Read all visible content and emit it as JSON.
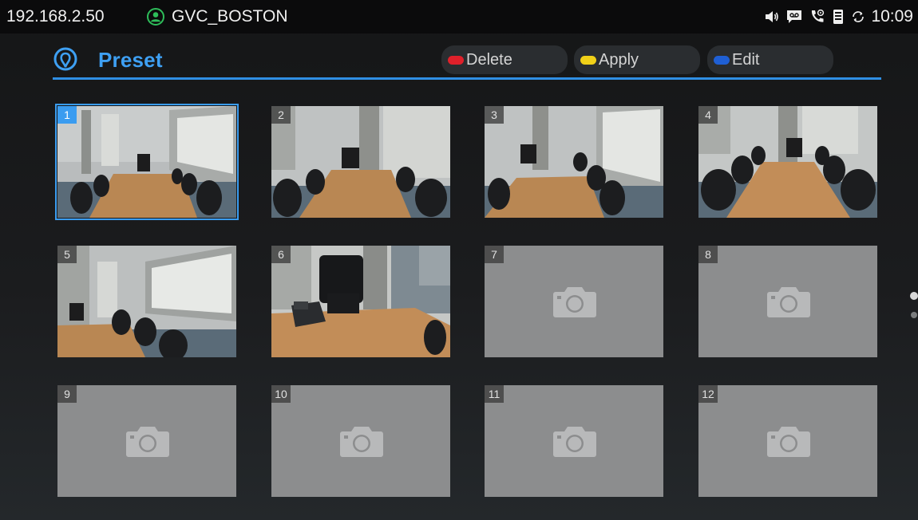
{
  "status_bar": {
    "ip": "192.168.2.50",
    "account_name": "GVC_BOSTON",
    "account_status_color": "#2ebd5a",
    "icons": [
      "volume-icon",
      "voicemail-icon",
      "call-settings-icon",
      "storage-icon",
      "sync-icon"
    ],
    "time": "10:09"
  },
  "header": {
    "title": "Preset",
    "accent_color": "#3ea0f3",
    "actions": [
      {
        "label": "Delete",
        "key_color": "#e0202a"
      },
      {
        "label": "Apply",
        "key_color": "#f0d018"
      },
      {
        "label": "Edit",
        "key_color": "#1f5fd4"
      }
    ]
  },
  "presets": [
    {
      "number": "1",
      "thumbnail": "conference-room-view",
      "selected": true
    },
    {
      "number": "2",
      "thumbnail": "conference-room-view"
    },
    {
      "number": "3",
      "thumbnail": "conference-room-view"
    },
    {
      "number": "4",
      "thumbnail": "conference-room-view"
    },
    {
      "number": "5",
      "thumbnail": "conference-room-view"
    },
    {
      "number": "6",
      "thumbnail": "conference-room-phone-view"
    },
    {
      "number": "7",
      "thumbnail": "camera-icon"
    },
    {
      "number": "8",
      "thumbnail": "camera-icon"
    },
    {
      "number": "9",
      "thumbnail": "camera-icon"
    },
    {
      "number": "10",
      "thumbnail": "camera-icon"
    },
    {
      "number": "11",
      "thumbnail": "camera-icon"
    },
    {
      "number": "12",
      "thumbnail": "camera-icon"
    }
  ],
  "pager": {
    "pages": 2,
    "current": 1
  }
}
